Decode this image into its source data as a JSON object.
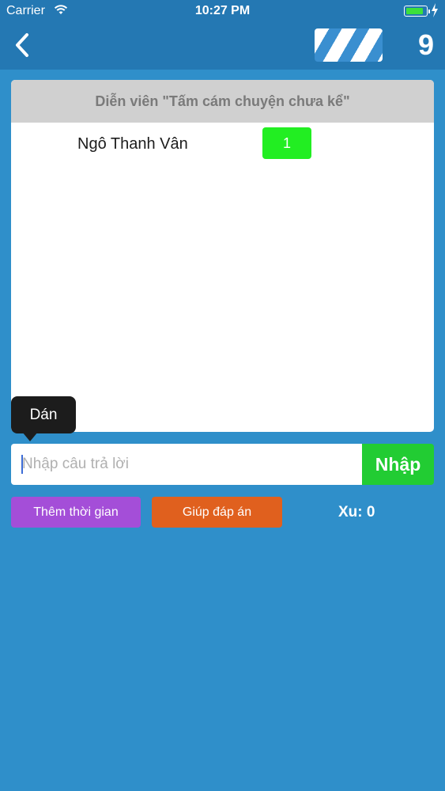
{
  "status_bar": {
    "carrier": "Carrier",
    "time": "10:27 PM",
    "battery_level": 0.8
  },
  "nav": {
    "level": "9"
  },
  "question": {
    "title": "Diễn viên \"Tấm cám chuyện chưa kể\"",
    "answers": [
      {
        "text": "Ngô Thanh Vân",
        "rank": "1"
      }
    ]
  },
  "tooltip": {
    "paste_label": "Dán"
  },
  "input": {
    "placeholder": "Nhập câu trả lời",
    "value": ""
  },
  "actions": {
    "submit_label": "Nhập",
    "add_time_label": "Thêm thời gian",
    "hint_label": "Giúp đáp án",
    "coins_text": "Xu: 0"
  },
  "colors": {
    "background": "#2f8fca",
    "bar": "#2478b3",
    "submit": "#22cc33",
    "add_time": "#a44ed8",
    "hint": "#e0601e",
    "badge": "#22ee22"
  },
  "icons": [
    "wifi-icon",
    "battery-icon",
    "charging-bolt-icon",
    "back-chevron-icon",
    "striped-progress-icon"
  ]
}
